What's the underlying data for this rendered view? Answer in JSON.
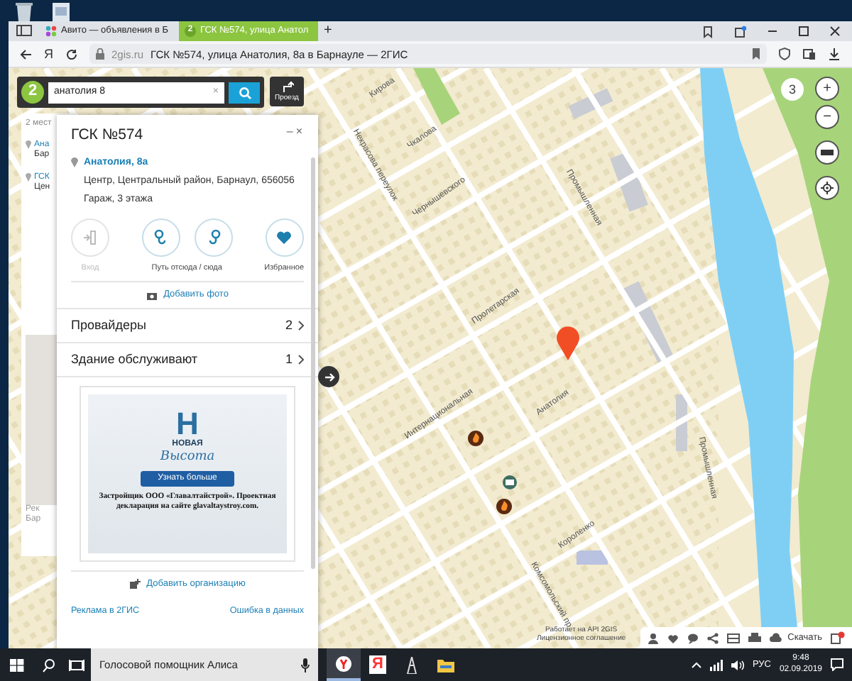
{
  "browser": {
    "tabs": [
      {
        "kind": "avito",
        "title": "Авито — объявления в Б",
        "selected": false
      },
      {
        "kind": "gis",
        "icon_text": "2",
        "title": "ГСК №574, улица Анатол",
        "selected": true
      }
    ],
    "new_tab": "+",
    "home_glyph": "Я",
    "domain": "2gis.ru",
    "page_title": "ГСК №574, улица Анатолия, 8а в Барнауле — 2ГИС"
  },
  "search": {
    "logo": "2",
    "value": "анатолия 8",
    "clear": "×",
    "route_label": "Проезд"
  },
  "results_behind": {
    "heading": "2 мест",
    "items": [
      {
        "link": "Ана",
        "line": "Бар"
      },
      {
        "link": "ГСК",
        "line": "Цен"
      }
    ],
    "ad_lines": [
      "Рек",
      "Бар"
    ]
  },
  "card": {
    "title": "ГСК №574",
    "minimize": "–",
    "close": "×",
    "address": "Анатолия, 8а",
    "locality": "Центр, Центральный район, Барнаул, 656056",
    "description": "Гараж, 3 этажа",
    "actions": [
      {
        "kind": "entrance",
        "label": "Вход",
        "disabled": true
      },
      {
        "kind": "route",
        "label": "Путь отсюда / сюда",
        "disabled": false
      },
      {
        "kind": "favorite",
        "label": "Избранное",
        "disabled": false
      }
    ],
    "add_photo": "Добавить фото",
    "rows": [
      {
        "label": "Провайдеры",
        "count": "2"
      },
      {
        "label": "Здание обслуживают",
        "count": "1"
      }
    ],
    "ad": {
      "logo_mark": "Н",
      "logo_top": "НОВАЯ",
      "logo_script": "Высота",
      "button": "Узнать больше",
      "text": "Застройщик ООО «Главалтайстрой». Проектная декларация на сайте glavaltaystroy.com."
    },
    "add_org": "Добавить организацию",
    "footer_links": [
      "Реклама в 2ГИС",
      "Ошибка в данных"
    ]
  },
  "map": {
    "zoom_level": "3",
    "zoom_in": "+",
    "zoom_out": "−",
    "streets": [
      "Кирова",
      "Чкалова",
      "Некрасова переулок",
      "Чернышевского",
      "Пролетарская",
      "Промышленная",
      "Интернациональная",
      "Анатолия",
      "Короленко",
      "Промышленная",
      "Комсомольский пр"
    ],
    "attribution": [
      "Работает на API 2GIS",
      "Лицензионное соглашение"
    ],
    "download_label": "Скачать"
  },
  "taskbar": {
    "search_placeholder": "Голосовой помощник Алиса",
    "apps": [
      {
        "kind": "yandex-browser",
        "active": true
      },
      {
        "kind": "yandex",
        "glyph": "Я",
        "active": false
      },
      {
        "kind": "tower",
        "active": false
      },
      {
        "kind": "folder",
        "active": false
      }
    ],
    "language": "РУС",
    "time": "9:48",
    "date": "02.09.2019"
  }
}
